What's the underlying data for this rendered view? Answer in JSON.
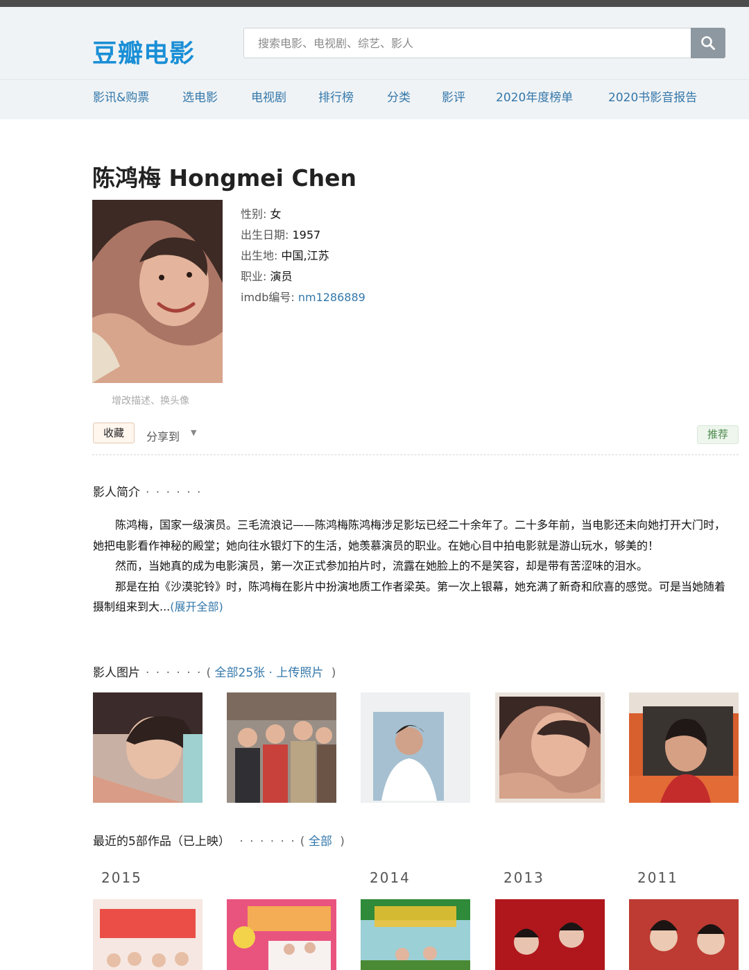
{
  "header": {
    "logo": "豆瓣电影",
    "search_placeholder": "搜索电影、电视剧、综艺、影人"
  },
  "nav": [
    "影讯&购票",
    "选电影",
    "电视剧",
    "排行榜",
    "分类",
    "影评",
    "2020年度榜单",
    "2020书影音报告"
  ],
  "person": {
    "title": "陈鸿梅 Hongmei Chen",
    "avatar_caption": "增改描述、换头像",
    "info": [
      {
        "key": "性别",
        "value": "女"
      },
      {
        "key": "出生日期",
        "value": "1957"
      },
      {
        "key": "出生地",
        "value": "中国,江苏"
      },
      {
        "key": "职业",
        "value": "演员"
      },
      {
        "key": "imdb编号",
        "value": "nm1286889"
      }
    ]
  },
  "actions": {
    "collect": "收藏",
    "share": "分享到",
    "recommend": "推荐"
  },
  "bio_section": {
    "heading": "影人简介",
    "dots": "· · · · · ·",
    "paragraphs": [
      "陈鸿梅，国家一级演员。三毛流浪记——陈鸿梅陈鸿梅涉足影坛已经二十余年了。二十多年前，当电影还未向她打开大门时，她把电影看作神秘的殿堂；她向往水银灯下的生活，她羡慕演员的职业。在她心目中拍电影就是游山玩水，够美的！",
      "然而，当她真的成为电影演员，第一次正式参加拍片时，流露在她脸上的不是笑容，却是带有苦涩味的泪水。",
      "那是在拍《沙漠驼铃》时，陈鸿梅在影片中扮演地质工作者梁英。第一次上银幕，她充满了新奇和欣喜的感觉。可是当她随着摄制组来到大..."
    ],
    "more": "(展开全部)"
  },
  "photos_section": {
    "heading": "影人图片",
    "dots": "· · · · · ·",
    "open": "(",
    "all": "全部25张",
    "sep": "·",
    "upload": "上传照片",
    "close": ")"
  },
  "works_section": {
    "heading": "最近的5部作品（已上映）",
    "dots": "· · · · · ·",
    "open": "(",
    "all": "全部",
    "close": ")",
    "years": [
      "2015",
      "2014",
      "2013",
      "2011"
    ]
  }
}
